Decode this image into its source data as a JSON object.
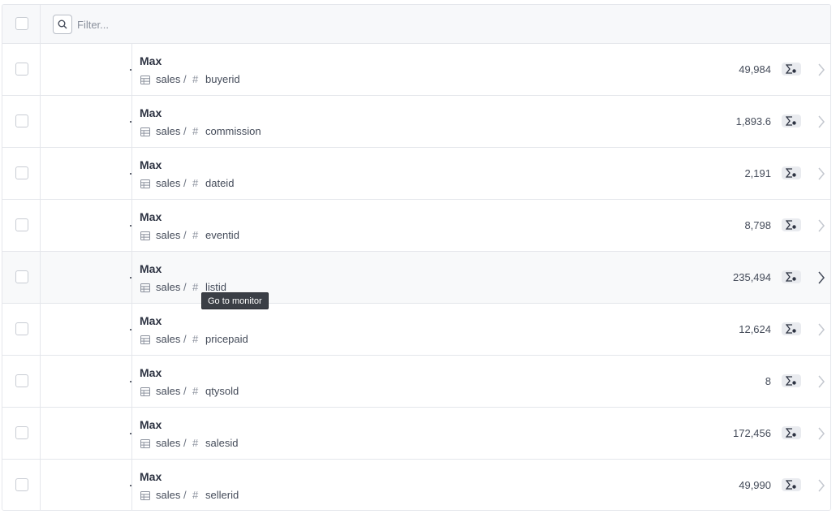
{
  "filter": {
    "placeholder": "Filter..."
  },
  "tooltip": {
    "text": "Go to monitor"
  },
  "rows": [
    {
      "title": "Max",
      "table": "sales",
      "separator": "/",
      "column": "buyerid",
      "value": "49,984"
    },
    {
      "title": "Max",
      "table": "sales",
      "separator": "/",
      "column": "commission",
      "value": "1,893.6"
    },
    {
      "title": "Max",
      "table": "sales",
      "separator": "/",
      "column": "dateid",
      "value": "2,191"
    },
    {
      "title": "Max",
      "table": "sales",
      "separator": "/",
      "column": "eventid",
      "value": "8,798"
    },
    {
      "title": "Max",
      "table": "sales",
      "separator": "/",
      "column": "listid",
      "value": "235,494"
    },
    {
      "title": "Max",
      "table": "sales",
      "separator": "/",
      "column": "pricepaid",
      "value": "12,624"
    },
    {
      "title": "Max",
      "table": "sales",
      "separator": "/",
      "column": "qtysold",
      "value": "8"
    },
    {
      "title": "Max",
      "table": "sales",
      "separator": "/",
      "column": "salesid",
      "value": "172,456"
    },
    {
      "title": "Max",
      "table": "sales",
      "separator": "/",
      "column": "sellerid",
      "value": "49,990"
    }
  ],
  "icons": {
    "search": "search-icon",
    "table": "table-icon",
    "column": "hash-icon",
    "monitor": "sum-monitor-icon",
    "row_action": "chevron-right-icon"
  },
  "colors": {
    "border": "#e4e6eb",
    "header_bg": "#f7f8fa",
    "hover_bg": "#f8f9fa",
    "tooltip_bg": "#3b3f46"
  }
}
